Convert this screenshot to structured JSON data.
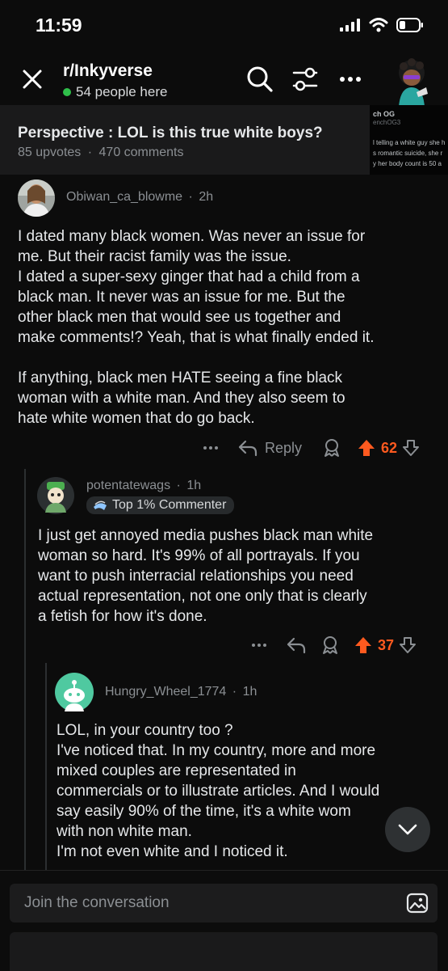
{
  "status_bar": {
    "time": "11:59"
  },
  "header": {
    "subreddit": "r/Inkyverse",
    "online": "54 people here"
  },
  "post": {
    "title": "Perspective : LOL is this true white boys?",
    "upvotes": "85 upvotes",
    "separator": "·",
    "comments": "470 comments",
    "thumbnail_lines": [
      "ch OG",
      "enchOG3",
      "l telling a white guy she h",
      "s romantic suicide, she r",
      "y her body count is 50 a"
    ]
  },
  "comments": [
    {
      "author": "Obiwan_ca_blowme",
      "time": "2h",
      "body": [
        "I dated many black women. Was never an issue for",
        "me. But their racist family was the issue.",
        "I dated a super-sexy ginger that had a child from a",
        "black man. It never was an issue for me. But the",
        "other black men that would see us together and",
        "make comments!? Yeah, that is what finally ended it.",
        "",
        "If anything, black men HATE seeing a fine black",
        "woman with a white man. And they also seem to",
        "hate white women that do go back."
      ],
      "reply_label": "Reply",
      "votes": "62"
    },
    {
      "author": "potentatewags",
      "time": "1h",
      "flair": "Top 1% Commenter",
      "body": [
        "I just get annoyed media pushes black man white",
        "woman so hard. It's 99% of all portrayals. If you",
        "want to push interracial relationships you need",
        "actual representation, not one only that is clearly",
        "a fetish for how it's done."
      ],
      "votes": "37"
    },
    {
      "author": "Hungry_Wheel_1774",
      "time": "1h",
      "body": [
        "LOL, in your country too ?",
        "I've noticed that. In my country, more and more",
        "mixed couples are representated in",
        "commercials or to illustrate articles. And I would",
        "say easily 90% of the time, it's a white wom",
        "with non white man.",
        "I'm not even white and I noticed it."
      ]
    }
  ],
  "composer": {
    "placeholder": "Join the conversation"
  },
  "colors": {
    "upvote_active": "#ff5a1f",
    "online_dot": "#2fbf4a",
    "background": "#0c0c0c"
  }
}
